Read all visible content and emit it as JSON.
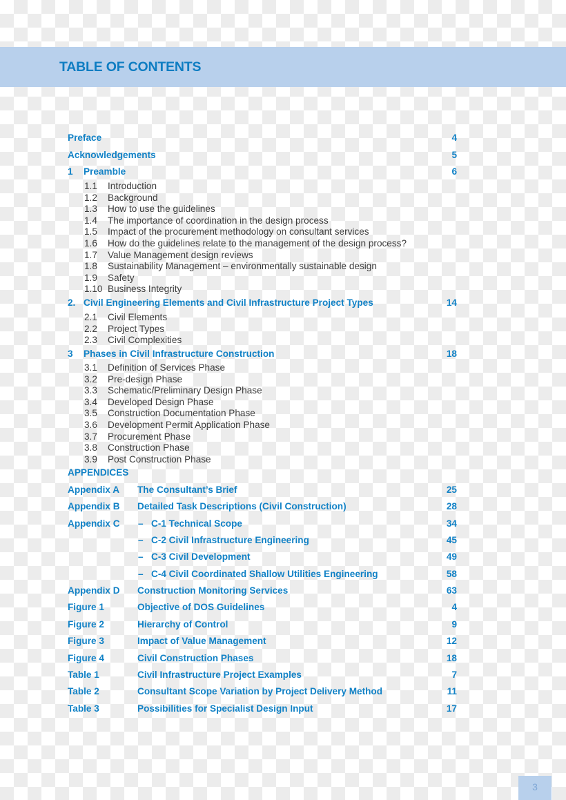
{
  "header": {
    "title": "TABLE OF CONTENTS"
  },
  "accent_color": "#1282c6",
  "band_color": "#b8d0ec",
  "main_entries": [
    {
      "number": "",
      "label": "Preface",
      "page": "4"
    },
    {
      "number": "",
      "label": "Acknowledgements",
      "page": "5"
    },
    {
      "number": "1",
      "label": "Preamble",
      "page": "6"
    }
  ],
  "section1_items": [
    {
      "number": "1.1",
      "label": "Introduction"
    },
    {
      "number": "1.2",
      "label": "Background"
    },
    {
      "number": "1.3",
      "label": "How to use the guidelines"
    },
    {
      "number": "1.4",
      "label": "The importance of coordination in the design process"
    },
    {
      "number": "1.5",
      "label": "Impact of the procurement methodology on consultant services"
    },
    {
      "number": "1.6",
      "label": "How do the guidelines relate to the management of the design process?"
    },
    {
      "number": "1.7",
      "label": "Value Management design reviews"
    },
    {
      "number": "1.8",
      "label": "Sustainability Management – environmentally sustainable design"
    },
    {
      "number": "1.9",
      "label": "Safety"
    },
    {
      "number": "1.10",
      "label": "Business Integrity"
    }
  ],
  "section2": {
    "number": "2.",
    "label": "Civil Engineering Elements and Civil Infrastructure Project Types",
    "page": "14"
  },
  "section2_items": [
    {
      "number": "2.1",
      "label": "Civil Elements"
    },
    {
      "number": "2.2",
      "label": "Project Types"
    },
    {
      "number": "2.3",
      "label": "Civil Complexities"
    }
  ],
  "section3": {
    "number": "3",
    "label": "Phases in Civil Infrastructure Construction",
    "page": "18"
  },
  "section3_items": [
    {
      "number": "3.1",
      "label": "Definition of Services Phase"
    },
    {
      "number": "3.2",
      "label": "Pre-design Phase"
    },
    {
      "number": "3.3",
      "label": "Schematic/Preliminary Design Phase"
    },
    {
      "number": "3.4",
      "label": "Developed Design Phase"
    },
    {
      "number": "3.5",
      "label": "Construction Documentation Phase"
    },
    {
      "number": "3.6",
      "label": "Development Permit Application Phase"
    },
    {
      "number": "3.7",
      "label": "Procurement Phase"
    },
    {
      "number": "3.8",
      "label": "Construction Phase"
    },
    {
      "number": "3.9",
      "label": "Post Construction Phase"
    }
  ],
  "appendices_heading": "APPENDICES",
  "appendix_entries": [
    {
      "ref": "Appendix A",
      "dash": "",
      "label": "The Consultant’s Brief",
      "page": "25"
    },
    {
      "ref": "Appendix B",
      "dash": "",
      "label": "Detailed Task Descriptions (Civil Construction)",
      "page": "28"
    },
    {
      "ref": "Appendix C",
      "dash": "–",
      "label": "C-1 Technical Scope",
      "page": "34"
    },
    {
      "ref": "",
      "dash": "–",
      "label": "C-2 Civil Infrastructure Engineering",
      "page": "45"
    },
    {
      "ref": "",
      "dash": "–",
      "label": "C-3 Civil Development",
      "page": "49"
    },
    {
      "ref": "",
      "dash": "–",
      "label": "C-4 Civil Coordinated Shallow Utilities Engineering",
      "page": "58"
    },
    {
      "ref": "Appendix D",
      "dash": "",
      "label": "Construction Monitoring Services",
      "page": "63"
    },
    {
      "ref": "Figure 1",
      "dash": "",
      "label": "Objective of DOS Guidelines",
      "page": "4"
    },
    {
      "ref": "Figure 2",
      "dash": "",
      "label": "Hierarchy of Control",
      "page": "9"
    },
    {
      "ref": "Figure 3",
      "dash": "",
      "label": "Impact of Value Management",
      "page": "12"
    },
    {
      "ref": "Figure 4",
      "dash": "",
      "label": "Civil Construction Phases",
      "page": "18"
    },
    {
      "ref": "Table 1",
      "dash": "",
      "label": "Civil Infrastructure Project Examples",
      "page": "7"
    },
    {
      "ref": "Table 2",
      "dash": "",
      "label": "Consultant Scope Variation by Project Delivery Method",
      "page": "11"
    },
    {
      "ref": "Table 3",
      "dash": "",
      "label": "Possibilities for Specialist Design Input",
      "page": "17"
    }
  ],
  "footer": {
    "page_number": "3"
  }
}
